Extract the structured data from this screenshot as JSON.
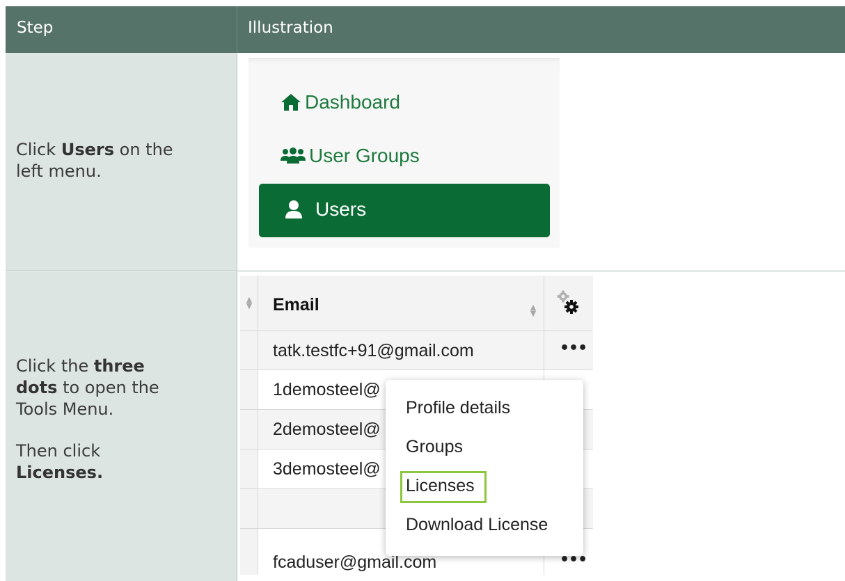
{
  "header": {
    "col_step": "Step",
    "col_illustration": "Illustration"
  },
  "steps": [
    {
      "line1_pre": "Click ",
      "line1_bold": "Users",
      "line1_post": " on the",
      "line2": "left menu."
    },
    {
      "p1_pre": "Click the ",
      "p1_bold_a": "three",
      "p1_bold_b": "dots",
      "p1_post": " to open the",
      "p1_line3": "Tools Menu.",
      "p2_line1": "Then click",
      "p2_bold": "Licenses."
    }
  ],
  "menu": {
    "items": [
      {
        "label": "Dashboard",
        "icon": "home-icon"
      },
      {
        "label": "User Groups",
        "icon": "users-group-icon"
      },
      {
        "label": "Users",
        "icon": "user-icon",
        "active": true
      }
    ],
    "colors": {
      "text": "#1d7a3e",
      "active_bg": "#0a6b34"
    }
  },
  "table": {
    "header_email": "Email",
    "rows": [
      "tatk.testfc+91@gmail.com",
      "1demosteel@",
      "2demosteel@",
      "3demosteel@",
      "fcaduser@gmail.com"
    ],
    "more_label": "•••"
  },
  "tools_menu": {
    "items": [
      "Profile details",
      "Groups",
      "Licenses",
      "Download License"
    ],
    "highlighted": "Licenses",
    "highlight_color": "#8cc63f"
  }
}
